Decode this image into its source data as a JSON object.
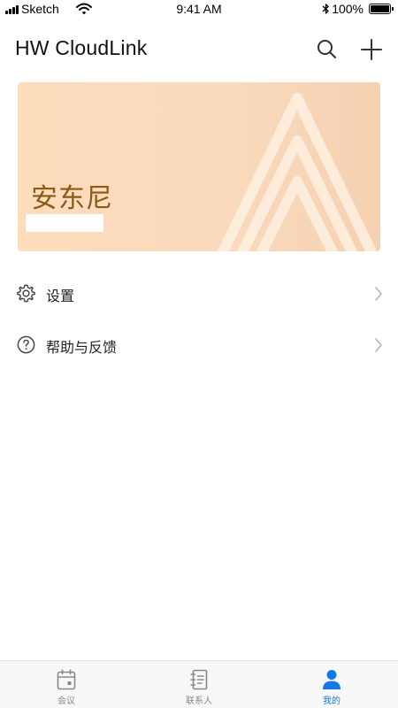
{
  "status_bar": {
    "carrier": "Sketch",
    "time": "9:41 AM",
    "battery_percent": "100%",
    "battery_level": 1.0,
    "signal_bars": 4
  },
  "header": {
    "title": "HW CloudLink",
    "search_icon": "search-icon",
    "add_icon": "plus-icon"
  },
  "profile": {
    "name": "安东尼",
    "colors": {
      "card_gradient_start": "#fcdcbb",
      "card_gradient_end": "#f5d1b2",
      "name_color": "#8a5a18"
    }
  },
  "menu": {
    "items": [
      {
        "label": "设置",
        "icon": "gear-icon"
      },
      {
        "label": "帮助与反馈",
        "icon": "help-circle-icon"
      }
    ]
  },
  "tab_bar": {
    "tabs": [
      {
        "label": "会议",
        "icon": "calendar-icon",
        "active": false
      },
      {
        "label": "联系人",
        "icon": "contacts-book-icon",
        "active": false
      },
      {
        "label": "我的",
        "icon": "person-icon",
        "active": true
      }
    ],
    "colors": {
      "active": "#1479e6",
      "inactive": "#8a8a8a"
    }
  }
}
